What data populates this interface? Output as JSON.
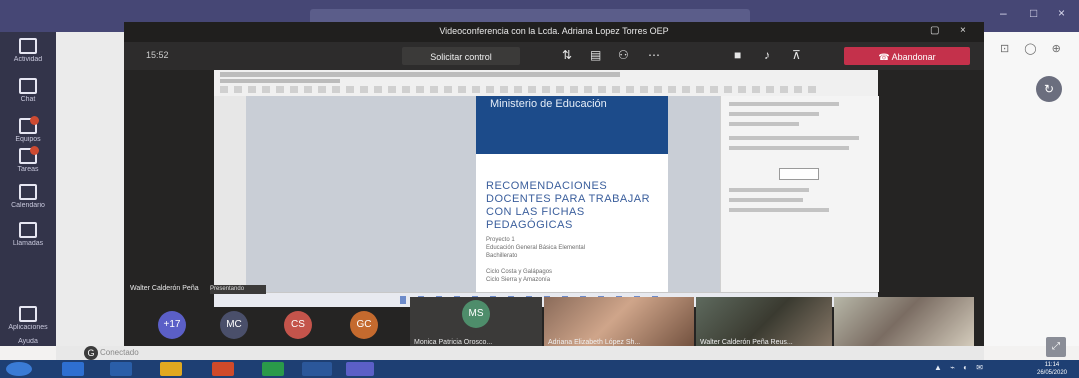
{
  "meeting": {
    "title": "Videoconferencia con la Lcda. Adriana Lopez Torres OEP",
    "timer": "15:52",
    "control_label": "Solicitar control",
    "hangup_label": "Abandonar"
  },
  "document": {
    "ministry": "Ministerio de Educación",
    "heading": "RECOMENDACIONES DOCENTES PARA TRABAJAR CON LAS FICHAS PEDAGÓGICAS",
    "body_lines": [
      "Proyecto 1",
      "Educación General Básica Elemental",
      "Bachillerato",
      "",
      "Ciclo Costa y Galápagos",
      "Ciclo Sierra y Amazonía"
    ]
  },
  "presenter": {
    "name": "Walter Calderón Peña",
    "tag": "Presentando"
  },
  "participants": {
    "more": "+17",
    "avatars": [
      "MC",
      "CS",
      "GC"
    ],
    "tile_initials": "MS",
    "tile_name": "Monica Patricia Orosco...",
    "cams": [
      "Adriana Elizabeth López Sh...",
      "Walter Calderón Peña Reus..."
    ]
  },
  "sidebar": [
    "Actividad",
    "Chat",
    "Equipos",
    "Tareas",
    "Calendario",
    "Llamadas",
    "Aplicaciones",
    "Ayuda"
  ],
  "user": {
    "initial": "G",
    "label": "Conectado"
  },
  "clock": {
    "time": "11:14",
    "date": "26/05/2020"
  },
  "colors": {
    "accent": "#464775",
    "hangup": "#c4314b",
    "banner": "#1c4b8a"
  }
}
